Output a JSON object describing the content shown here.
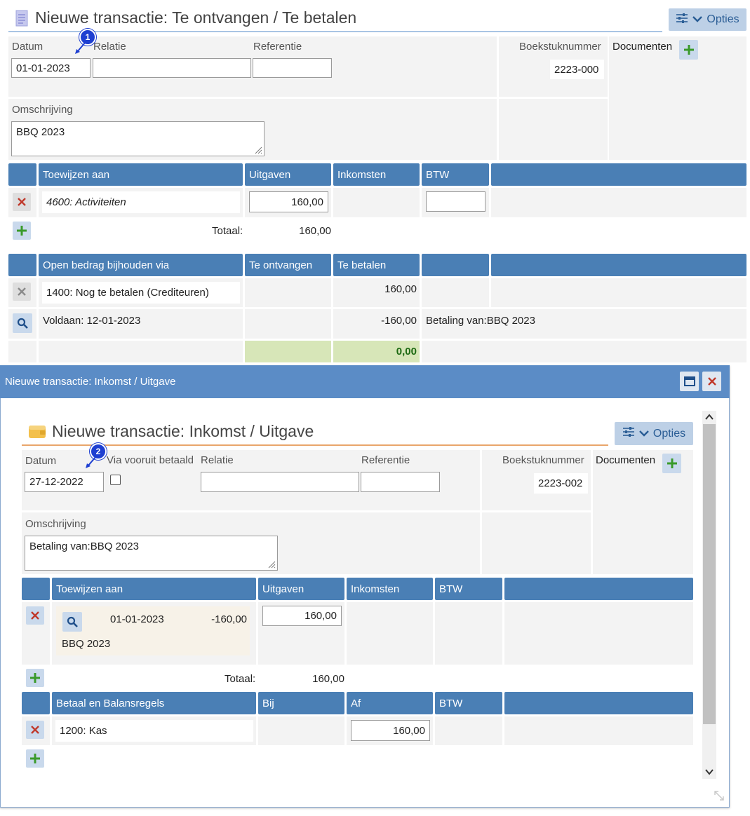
{
  "top_form": {
    "title": "Nieuwe transactie: Te ontvangen / Te betalen",
    "opties_label": "Opties",
    "badge": "1",
    "datum_label": "Datum",
    "datum_value": "01-01-2023",
    "relatie_label": "Relatie",
    "relatie_value": "",
    "referentie_label": "Referentie",
    "referentie_value": "",
    "boekstuknummer_label": "Boekstuknummer",
    "boekstuknummer_value": "2223-000",
    "documenten_label": "Documenten",
    "omschrijving_label": "Omschrijving",
    "omschrijving_value": "BBQ 2023",
    "alloc_table": {
      "headers": [
        "Toewijzen aan",
        "Uitgaven",
        "Inkomsten",
        "BTW"
      ],
      "row": {
        "account": "4600: Activiteiten",
        "uitgaven": "160,00",
        "btw": ""
      },
      "totaal_label": "Totaal:",
      "totaal_value": "160,00"
    },
    "open_table": {
      "headers": [
        "Open bedrag bijhouden via",
        "Te ontvangen",
        "Te betalen"
      ],
      "row1": {
        "account": "1400: Nog te betalen (Crediteuren)",
        "te_betalen": "160,00"
      },
      "row2": {
        "label": "Voldaan: 12-01-2023",
        "te_betalen": "-160,00",
        "note": "Betaling van:BBQ 2023"
      },
      "total": "0,00"
    }
  },
  "dialog": {
    "window_title": "Nieuwe transactie: Inkomst / Uitgave",
    "title": "Nieuwe transactie: Inkomst / Uitgave",
    "opties_label": "Opties",
    "badge": "2",
    "datum_label": "Datum",
    "datum_value": "27-12-2022",
    "vooruit_label": "Via vooruit betaald",
    "relatie_label": "Relatie",
    "relatie_value": "",
    "referentie_label": "Referentie",
    "referentie_value": "",
    "boekstuknummer_label": "Boekstuknummer",
    "boekstuknummer_value": "2223-002",
    "documenten_label": "Documenten",
    "omschrijving_label": "Omschrijving",
    "omschrijving_value": "Betaling van:BBQ 2023",
    "alloc_table": {
      "headers": [
        "Toewijzen aan",
        "Uitgaven",
        "Inkomsten",
        "BTW"
      ],
      "row": {
        "date": "01-01-2023",
        "amount": "-160,00",
        "desc": "BBQ 2023",
        "uitgaven": "160,00"
      },
      "totaal_label": "Totaal:",
      "totaal_value": "160,00"
    },
    "betaal_table": {
      "headers": [
        "Betaal en Balansregels",
        "Bij",
        "Af",
        "BTW"
      ],
      "row": {
        "account": "1200: Kas",
        "af": "160,00"
      }
    }
  },
  "colors": {
    "header_blue": "#4a7fb5",
    "dialog_bar": "#5b8cc6",
    "total_green": "#d7e6b8",
    "accent_orange": "#e9a56b"
  }
}
